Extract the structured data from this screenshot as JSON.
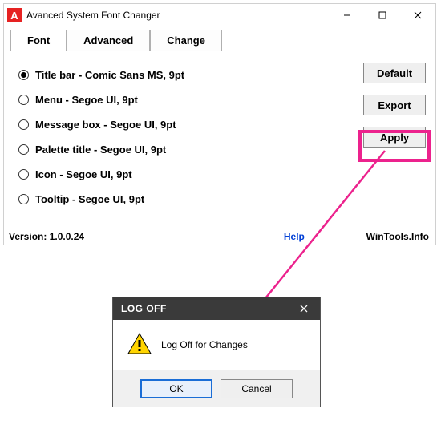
{
  "main": {
    "title": "Avanced System Font Changer",
    "tabs": [
      {
        "label": "Font",
        "active": true
      },
      {
        "label": "Advanced",
        "active": false
      },
      {
        "label": "Change",
        "active": false
      }
    ],
    "options": [
      {
        "label": "Title bar - Comic Sans MS, 9pt",
        "checked": true
      },
      {
        "label": "Menu - Segoe UI, 9pt",
        "checked": false
      },
      {
        "label": "Message box - Segoe UI, 9pt",
        "checked": false
      },
      {
        "label": "Palette title - Segoe UI, 9pt",
        "checked": false
      },
      {
        "label": "Icon - Segoe UI, 9pt",
        "checked": false
      },
      {
        "label": "Tooltip - Segoe UI, 9pt",
        "checked": false
      }
    ],
    "buttons": {
      "default": "Default",
      "export": "Export",
      "apply": "Apply"
    },
    "footer": {
      "version": "Version: 1.0.0.24",
      "help": "Help",
      "site": "WinTools.Info"
    }
  },
  "dialog": {
    "title": "LOG OFF",
    "message": "Log Off for Changes",
    "ok": "OK",
    "cancel": "Cancel"
  },
  "annotation": {
    "highlight_color": "#ec228d"
  }
}
